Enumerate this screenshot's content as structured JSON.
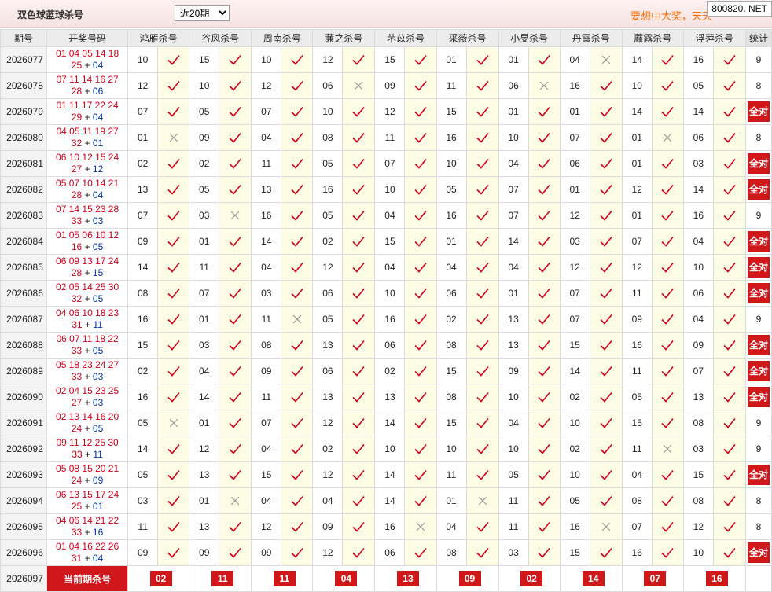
{
  "header": {
    "title": "双色球蓝球杀号",
    "period_select": "近20期",
    "slogan": "要想中大奖，天天",
    "site_badge": "800820. NET"
  },
  "table": {
    "col_period": "期号",
    "col_draw": "开奖号码",
    "experts": [
      "鸿雁杀号",
      "谷风杀号",
      "周南杀号",
      "蒹之杀号",
      "芣苡杀号",
      "采薇杀号",
      "小旻杀号",
      "丹霞杀号",
      "蘼露杀号",
      "浮萍杀号"
    ],
    "col_stat": "统计",
    "rows": [
      {
        "period": "2026077",
        "reds": "01 04 05 14 18",
        "reds2": "25",
        "blue": "04",
        "kills": [
          "10",
          "15",
          "10",
          "12",
          "15",
          "01",
          "01",
          "04",
          "14",
          "16"
        ],
        "hits": [
          true,
          true,
          true,
          true,
          true,
          true,
          true,
          false,
          true,
          true
        ],
        "stat": "9"
      },
      {
        "period": "2026078",
        "reds": "07 11 14 16 27",
        "reds2": "28",
        "blue": "06",
        "kills": [
          "12",
          "10",
          "12",
          "06",
          "09",
          "11",
          "06",
          "16",
          "10",
          "05"
        ],
        "hits": [
          true,
          true,
          true,
          false,
          true,
          true,
          false,
          true,
          true,
          true
        ],
        "stat": "8"
      },
      {
        "period": "2026079",
        "reds": "01 11 17 22 24",
        "reds2": "29",
        "blue": "04",
        "kills": [
          "07",
          "05",
          "07",
          "10",
          "12",
          "15",
          "01",
          "01",
          "14",
          "14"
        ],
        "hits": [
          true,
          true,
          true,
          true,
          true,
          true,
          true,
          true,
          true,
          true
        ],
        "stat": "全对"
      },
      {
        "period": "2026080",
        "reds": "04 05 11 19 27",
        "reds2": "32",
        "blue": "01",
        "kills": [
          "01",
          "09",
          "04",
          "08",
          "11",
          "16",
          "10",
          "07",
          "01",
          "06"
        ],
        "hits": [
          false,
          true,
          true,
          true,
          true,
          true,
          true,
          true,
          false,
          true
        ],
        "stat": "8"
      },
      {
        "period": "2026081",
        "reds": "06 10 12 15 24",
        "reds2": "27",
        "blue": "12",
        "kills": [
          "02",
          "02",
          "11",
          "05",
          "07",
          "10",
          "04",
          "06",
          "01",
          "03"
        ],
        "hits": [
          true,
          true,
          true,
          true,
          true,
          true,
          true,
          true,
          true,
          true
        ],
        "stat": "全对"
      },
      {
        "period": "2026082",
        "reds": "05 07 10 14 21",
        "reds2": "28",
        "blue": "04",
        "kills": [
          "13",
          "05",
          "13",
          "16",
          "10",
          "05",
          "07",
          "01",
          "12",
          "14"
        ],
        "hits": [
          true,
          true,
          true,
          true,
          true,
          true,
          true,
          true,
          true,
          true
        ],
        "stat": "全对"
      },
      {
        "period": "2026083",
        "reds": "07 14 15 23 28",
        "reds2": "33",
        "blue": "03",
        "kills": [
          "07",
          "03",
          "16",
          "05",
          "04",
          "16",
          "07",
          "12",
          "01",
          "16"
        ],
        "hits": [
          true,
          false,
          true,
          true,
          true,
          true,
          true,
          true,
          true,
          true
        ],
        "stat": "9"
      },
      {
        "period": "2026084",
        "reds": "01 05 06 10 12",
        "reds2": "16",
        "blue": "05",
        "kills": [
          "09",
          "01",
          "14",
          "02",
          "15",
          "01",
          "14",
          "03",
          "07",
          "04"
        ],
        "hits": [
          true,
          true,
          true,
          true,
          true,
          true,
          true,
          true,
          true,
          true
        ],
        "stat": "全对"
      },
      {
        "period": "2026085",
        "reds": "06 09 13 17 24",
        "reds2": "28",
        "blue": "15",
        "kills": [
          "14",
          "11",
          "04",
          "12",
          "04",
          "04",
          "04",
          "12",
          "12",
          "10"
        ],
        "hits": [
          true,
          true,
          true,
          true,
          true,
          true,
          true,
          true,
          true,
          true
        ],
        "stat": "全对"
      },
      {
        "period": "2026086",
        "reds": "02 05 14 25 30",
        "reds2": "32",
        "blue": "05",
        "kills": [
          "08",
          "07",
          "03",
          "06",
          "10",
          "06",
          "01",
          "07",
          "11",
          "06"
        ],
        "hits": [
          true,
          true,
          true,
          true,
          true,
          true,
          true,
          true,
          true,
          true
        ],
        "stat": "全对"
      },
      {
        "period": "2026087",
        "reds": "04 06 10 18 23",
        "reds2": "31",
        "blue": "11",
        "kills": [
          "16",
          "01",
          "11",
          "05",
          "16",
          "02",
          "13",
          "07",
          "09",
          "04"
        ],
        "hits": [
          true,
          true,
          false,
          true,
          true,
          true,
          true,
          true,
          true,
          true
        ],
        "stat": "9"
      },
      {
        "period": "2026088",
        "reds": "06 07 11 18 22",
        "reds2": "33",
        "blue": "05",
        "kills": [
          "15",
          "03",
          "08",
          "13",
          "06",
          "08",
          "13",
          "15",
          "16",
          "09"
        ],
        "hits": [
          true,
          true,
          true,
          true,
          true,
          true,
          true,
          true,
          true,
          true
        ],
        "stat": "全对"
      },
      {
        "period": "2026089",
        "reds": "05 18 23 24 27",
        "reds2": "33",
        "blue": "03",
        "kills": [
          "02",
          "04",
          "09",
          "06",
          "02",
          "15",
          "09",
          "14",
          "11",
          "07"
        ],
        "hits": [
          true,
          true,
          true,
          true,
          true,
          true,
          true,
          true,
          true,
          true
        ],
        "stat": "全对"
      },
      {
        "period": "2026090",
        "reds": "02 04 15 23 25",
        "reds2": "27",
        "blue": "03",
        "kills": [
          "16",
          "14",
          "11",
          "13",
          "13",
          "08",
          "10",
          "02",
          "05",
          "13"
        ],
        "hits": [
          true,
          true,
          true,
          true,
          true,
          true,
          true,
          true,
          true,
          true
        ],
        "stat": "全对"
      },
      {
        "period": "2026091",
        "reds": "02 13 14 16 20",
        "reds2": "24",
        "blue": "05",
        "kills": [
          "05",
          "01",
          "07",
          "12",
          "14",
          "15",
          "04",
          "10",
          "15",
          "08"
        ],
        "hits": [
          false,
          true,
          true,
          true,
          true,
          true,
          true,
          true,
          true,
          true
        ],
        "stat": "9"
      },
      {
        "period": "2026092",
        "reds": "09 11 12 25 30",
        "reds2": "33",
        "blue": "11",
        "kills": [
          "14",
          "12",
          "04",
          "02",
          "10",
          "10",
          "10",
          "02",
          "11",
          "03"
        ],
        "hits": [
          true,
          true,
          true,
          true,
          true,
          true,
          true,
          true,
          false,
          true
        ],
        "stat": "9"
      },
      {
        "period": "2026093",
        "reds": "05 08 15 20 21",
        "reds2": "24",
        "blue": "09",
        "kills": [
          "05",
          "13",
          "15",
          "12",
          "14",
          "11",
          "05",
          "10",
          "04",
          "15"
        ],
        "hits": [
          true,
          true,
          true,
          true,
          true,
          true,
          true,
          true,
          true,
          true
        ],
        "stat": "全对"
      },
      {
        "period": "2026094",
        "reds": "06 13 15 17 24",
        "reds2": "25",
        "blue": "01",
        "kills": [
          "03",
          "01",
          "04",
          "04",
          "14",
          "01",
          "11",
          "05",
          "08",
          "08"
        ],
        "hits": [
          true,
          false,
          true,
          true,
          true,
          false,
          true,
          true,
          true,
          true
        ],
        "stat": "8"
      },
      {
        "period": "2026095",
        "reds": "04 06 14 21 22",
        "reds2": "33",
        "blue": "16",
        "kills": [
          "11",
          "13",
          "12",
          "09",
          "16",
          "04",
          "11",
          "16",
          "07",
          "12"
        ],
        "hits": [
          true,
          true,
          true,
          true,
          false,
          true,
          true,
          false,
          true,
          true
        ],
        "stat": "8"
      },
      {
        "period": "2026096",
        "reds": "01 04 16 22 26",
        "reds2": "31",
        "blue": "04",
        "kills": [
          "09",
          "09",
          "09",
          "12",
          "06",
          "08",
          "03",
          "15",
          "16",
          "10"
        ],
        "hits": [
          true,
          true,
          true,
          true,
          true,
          true,
          true,
          true,
          true,
          true
        ],
        "stat": "全对"
      }
    ],
    "current": {
      "period": "2026097",
      "label": "当前期杀号",
      "kills": [
        "02",
        "11",
        "11",
        "04",
        "13",
        "09",
        "02",
        "14",
        "07",
        "16"
      ]
    }
  },
  "colors": {
    "check": "#d0021b",
    "cross": "#999999",
    "badge": "#d0181b",
    "mark_bg": "#fdfde6"
  },
  "icons": {
    "hit": "check-icon",
    "miss": "cross-icon"
  }
}
